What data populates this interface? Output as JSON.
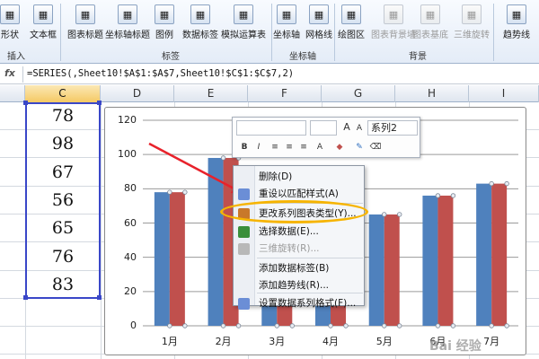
{
  "ribbon": {
    "buttons": [
      {
        "label": "形状",
        "icon": "shapes-icon",
        "disabled": false
      },
      {
        "label": "文本框",
        "icon": "textbox-icon",
        "disabled": false
      },
      {
        "label": "图表标题",
        "icon": "chart-title-icon",
        "disabled": false
      },
      {
        "label": "坐标轴标题",
        "icon": "axis-title-icon",
        "disabled": false
      },
      {
        "label": "图例",
        "icon": "legend-icon",
        "disabled": false
      },
      {
        "label": "数据标签",
        "icon": "data-labels-icon",
        "disabled": false
      },
      {
        "label": "模拟运算表",
        "icon": "data-table-icon",
        "disabled": false
      },
      {
        "label": "坐标轴",
        "icon": "axes-icon",
        "disabled": false
      },
      {
        "label": "网格线",
        "icon": "gridlines-icon",
        "disabled": false
      },
      {
        "label": "绘图区",
        "icon": "plot-area-icon",
        "disabled": false
      },
      {
        "label": "图表背景墙",
        "icon": "chart-wall-icon",
        "disabled": true
      },
      {
        "label": "图表基底",
        "icon": "chart-floor-icon",
        "disabled": true
      },
      {
        "label": "三维旋转",
        "icon": "3d-rotation-icon",
        "disabled": true
      },
      {
        "label": "趋势线",
        "icon": "trendline-icon",
        "disabled": false
      }
    ],
    "groups": [
      "插入",
      "标签",
      "坐标轴",
      "背景"
    ]
  },
  "formula_bar": {
    "fx": "fx",
    "formula": "=SERIES(,Sheet10!$A$1:$A$7,Sheet10!$C$1:$C$7,2)"
  },
  "columns": [
    "C",
    "D",
    "E",
    "F",
    "G",
    "H",
    "I"
  ],
  "cells": [
    "78",
    "98",
    "67",
    "56",
    "65",
    "76",
    "83"
  ],
  "mini_toolbar": {
    "series_name": "系列2",
    "font_grow": "A",
    "font_shrink": "A",
    "bold": "B",
    "italic": "I"
  },
  "context_menu": [
    {
      "label": "删除(D)",
      "disabled": false
    },
    {
      "label": "重设以匹配样式(A)",
      "disabled": false
    },
    {
      "label": "更改系列图表类型(Y)...",
      "disabled": false
    },
    {
      "label": "选择数据(E)...",
      "disabled": false
    },
    {
      "label": "三维旋转(R)...",
      "disabled": true
    },
    {
      "label": "添加数据标签(B)",
      "disabled": false
    },
    {
      "label": "添加趋势线(R)...",
      "disabled": false
    },
    {
      "label": "设置数据系列格式(F)...",
      "disabled": false
    }
  ],
  "colors": {
    "series1": "#4f81bd",
    "series2": "#c0504d",
    "highlight": "#f6b400",
    "arrow": "#e8222b"
  },
  "chart_data": {
    "type": "bar",
    "categories": [
      "1月",
      "2月",
      "3月",
      "4月",
      "5月",
      "6月",
      "7月"
    ],
    "series": [
      {
        "values": [
          78,
          98,
          67,
          56,
          65,
          76,
          83
        ]
      },
      {
        "values": [
          78,
          98,
          67,
          56,
          65,
          76,
          83
        ]
      }
    ],
    "yticks": [
      "0",
      "20",
      "40",
      "60",
      "80",
      "100",
      "120"
    ],
    "ylim": [
      0,
      120
    ],
    "grid": true,
    "legend": "none"
  },
  "watermark": "Bai 经验"
}
